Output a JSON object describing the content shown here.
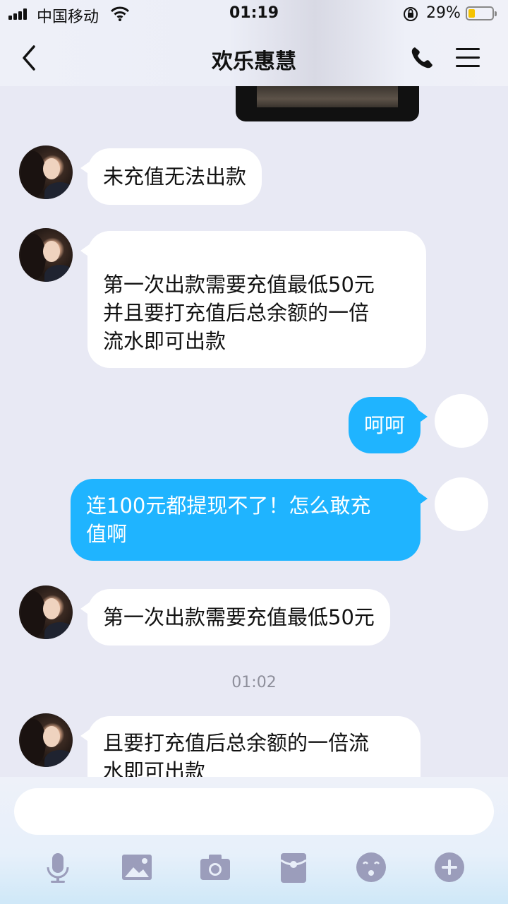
{
  "status_bar": {
    "carrier": "中国移动",
    "time": "01:19",
    "battery_percent": "29%",
    "battery_level": 0.29,
    "battery_color": "#f5c300",
    "icons": [
      "signal-icon",
      "wifi-icon",
      "orientation-lock-icon",
      "battery-icon"
    ]
  },
  "header": {
    "title": "欢乐惠慧",
    "icons": [
      "back-arrow-icon",
      "phone-icon",
      "menu-icon"
    ]
  },
  "messages": [
    {
      "side": "incoming",
      "text": "未充值无法出款"
    },
    {
      "side": "incoming",
      "lines": [
        "第一次出款需要充值最低50元",
        "并且要打充值后总余额的一倍",
        "流水即可出款"
      ]
    },
    {
      "side": "outgoing",
      "text": "呵呵"
    },
    {
      "side": "outgoing",
      "lines": [
        "连100元都提现不了！怎么敢充",
        "值啊"
      ]
    },
    {
      "side": "incoming",
      "text": "第一次出款需要充值最低50元"
    },
    {
      "side": "incoming",
      "lines": [
        "且要打充值后总余额的一倍流",
        "水即可出款"
      ]
    }
  ],
  "timestamp": "01:02",
  "colors": {
    "outgoing_bubble": "#1fb4ff",
    "incoming_bubble": "#ffffff",
    "chat_background": "#e8e9f4",
    "toolbar_icon": "#9b9dbb"
  },
  "toolbar": {
    "icons": [
      "microphone-icon",
      "image-icon",
      "camera-icon",
      "red-packet-icon",
      "emoji-icon",
      "plus-icon"
    ]
  }
}
